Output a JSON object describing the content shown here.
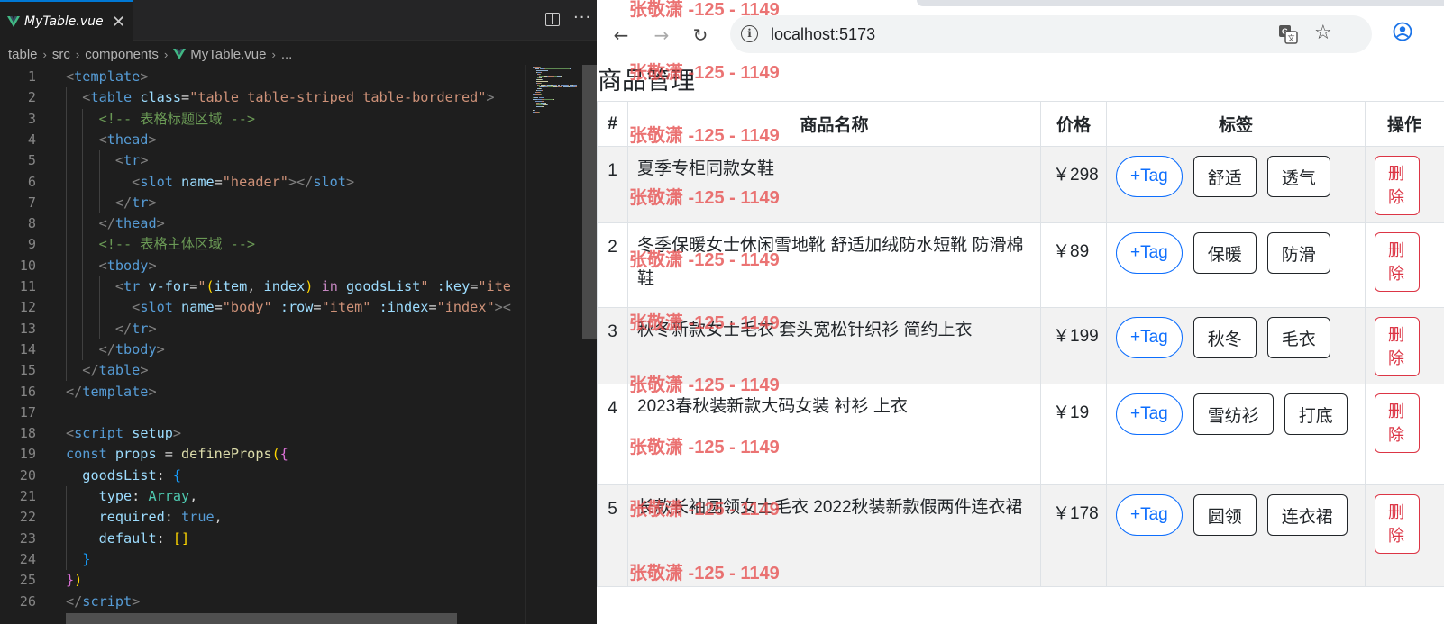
{
  "editor": {
    "tab_label": "MyTable.vue",
    "tab_close": "✕",
    "more_glyph": "···",
    "breadcrumb": [
      "table",
      "src",
      "components",
      "MyTable.vue",
      "..."
    ],
    "breadcrumb_sep": "›",
    "line_numbers": [
      "1",
      "2",
      "3",
      "4",
      "5",
      "6",
      "7",
      "8",
      "9",
      "10",
      "11",
      "12",
      "13",
      "14",
      "15",
      "16",
      "17",
      "18",
      "19",
      "20",
      "21",
      "22",
      "23",
      "24",
      "25",
      "26"
    ],
    "code": [
      [
        [
          "t-br",
          "<"
        ],
        [
          "t-tag",
          "template"
        ],
        [
          "t-br",
          ">"
        ]
      ],
      [
        [
          "t-d",
          "  "
        ],
        [
          "t-br",
          "<"
        ],
        [
          "t-tag",
          "table"
        ],
        [
          "t-d",
          " "
        ],
        [
          "t-attr",
          "class"
        ],
        [
          "t-d",
          "="
        ],
        [
          "t-str",
          "\"table table-striped table-bordered\""
        ],
        [
          "t-br",
          ">"
        ]
      ],
      [
        [
          "t-d",
          "    "
        ],
        [
          "t-com",
          "<!-- 表格标题区域 -->"
        ]
      ],
      [
        [
          "t-d",
          "    "
        ],
        [
          "t-br",
          "<"
        ],
        [
          "t-tag",
          "thead"
        ],
        [
          "t-br",
          ">"
        ]
      ],
      [
        [
          "t-d",
          "      "
        ],
        [
          "t-br",
          "<"
        ],
        [
          "t-tag",
          "tr"
        ],
        [
          "t-br",
          ">"
        ]
      ],
      [
        [
          "t-d",
          "        "
        ],
        [
          "t-br",
          "<"
        ],
        [
          "t-tag",
          "slot"
        ],
        [
          "t-d",
          " "
        ],
        [
          "t-attr",
          "name"
        ],
        [
          "t-d",
          "="
        ],
        [
          "t-str",
          "\"header\""
        ],
        [
          "t-br",
          "></"
        ],
        [
          "t-tag",
          "slot"
        ],
        [
          "t-br",
          ">"
        ]
      ],
      [
        [
          "t-d",
          "      "
        ],
        [
          "t-br",
          "</"
        ],
        [
          "t-tag",
          "tr"
        ],
        [
          "t-br",
          ">"
        ]
      ],
      [
        [
          "t-d",
          "    "
        ],
        [
          "t-br",
          "</"
        ],
        [
          "t-tag",
          "thead"
        ],
        [
          "t-br",
          ">"
        ]
      ],
      [
        [
          "t-d",
          "    "
        ],
        [
          "t-com",
          "<!-- 表格主体区域 -->"
        ]
      ],
      [
        [
          "t-d",
          "    "
        ],
        [
          "t-br",
          "<"
        ],
        [
          "t-tag",
          "tbody"
        ],
        [
          "t-br",
          ">"
        ]
      ],
      [
        [
          "t-d",
          "      "
        ],
        [
          "t-br",
          "<"
        ],
        [
          "t-tag",
          "tr"
        ],
        [
          "t-d",
          " "
        ],
        [
          "t-attr",
          "v-for"
        ],
        [
          "t-d",
          "="
        ],
        [
          "t-str",
          "\""
        ],
        [
          "t-p1",
          "("
        ],
        [
          "t-var",
          "item"
        ],
        [
          "t-d",
          ", "
        ],
        [
          "t-var",
          "index"
        ],
        [
          "t-p1",
          ")"
        ],
        [
          "t-d",
          " "
        ],
        [
          "t-ctl",
          "in"
        ],
        [
          "t-d",
          " "
        ],
        [
          "t-var",
          "goodsList"
        ],
        [
          "t-str",
          "\""
        ],
        [
          "t-d",
          " "
        ],
        [
          "t-attr",
          ":key"
        ],
        [
          "t-d",
          "="
        ],
        [
          "t-str",
          "\"ite"
        ]
      ],
      [
        [
          "t-d",
          "        "
        ],
        [
          "t-br",
          "<"
        ],
        [
          "t-tag",
          "slot"
        ],
        [
          "t-d",
          " "
        ],
        [
          "t-attr",
          "name"
        ],
        [
          "t-d",
          "="
        ],
        [
          "t-str",
          "\"body\""
        ],
        [
          "t-d",
          " "
        ],
        [
          "t-attr",
          ":row"
        ],
        [
          "t-d",
          "="
        ],
        [
          "t-str",
          "\"item\""
        ],
        [
          "t-d",
          " "
        ],
        [
          "t-attr",
          ":index"
        ],
        [
          "t-d",
          "="
        ],
        [
          "t-str",
          "\"index\""
        ],
        [
          "t-br",
          "><"
        ]
      ],
      [
        [
          "t-d",
          "      "
        ],
        [
          "t-br",
          "</"
        ],
        [
          "t-tag",
          "tr"
        ],
        [
          "t-br",
          ">"
        ]
      ],
      [
        [
          "t-d",
          "    "
        ],
        [
          "t-br",
          "</"
        ],
        [
          "t-tag",
          "tbody"
        ],
        [
          "t-br",
          ">"
        ]
      ],
      [
        [
          "t-d",
          "  "
        ],
        [
          "t-br",
          "</"
        ],
        [
          "t-tag",
          "table"
        ],
        [
          "t-br",
          ">"
        ]
      ],
      [
        [
          "t-br",
          "</"
        ],
        [
          "t-tag",
          "template"
        ],
        [
          "t-br",
          ">"
        ]
      ],
      [],
      [
        [
          "t-br",
          "<"
        ],
        [
          "t-tag",
          "script"
        ],
        [
          "t-d",
          " "
        ],
        [
          "t-attr",
          "setup"
        ],
        [
          "t-br",
          ">"
        ]
      ],
      [
        [
          "t-kw",
          "const"
        ],
        [
          "t-d",
          " "
        ],
        [
          "t-var",
          "props"
        ],
        [
          "t-d",
          " = "
        ],
        [
          "t-fn",
          "defineProps"
        ],
        [
          "t-p1",
          "("
        ],
        [
          "t-p2",
          "{"
        ]
      ],
      [
        [
          "t-d",
          "  "
        ],
        [
          "t-var",
          "goodsList"
        ],
        [
          "t-d",
          ": "
        ],
        [
          "t-p3",
          "{"
        ]
      ],
      [
        [
          "t-d",
          "    "
        ],
        [
          "t-var",
          "type"
        ],
        [
          "t-d",
          ": "
        ],
        [
          "t-type",
          "Array"
        ],
        [
          "t-d",
          ","
        ]
      ],
      [
        [
          "t-d",
          "    "
        ],
        [
          "t-var",
          "required"
        ],
        [
          "t-d",
          ": "
        ],
        [
          "t-kw",
          "true"
        ],
        [
          "t-d",
          ","
        ]
      ],
      [
        [
          "t-d",
          "    "
        ],
        [
          "t-var",
          "default"
        ],
        [
          "t-d",
          ": "
        ],
        [
          "t-p1",
          "[]"
        ]
      ],
      [
        [
          "t-d",
          "  "
        ],
        [
          "t-p3",
          "}"
        ]
      ],
      [
        [
          "t-p2",
          "}"
        ],
        [
          "t-p1",
          ")"
        ]
      ],
      [
        [
          "t-br",
          "</"
        ],
        [
          "t-tag",
          "script"
        ],
        [
          "t-br",
          ">"
        ]
      ]
    ]
  },
  "browser": {
    "back_glyph": "←",
    "forward_glyph": "→",
    "reload_glyph": "↻",
    "url": "localhost:5173",
    "star_glyph": "☆",
    "info_glyph": "i",
    "icons": [
      "back-icon",
      "forward-icon",
      "reload-icon",
      "info-icon",
      "translate-icon",
      "star-icon",
      "profile-icon"
    ]
  },
  "page": {
    "title": "商品管理",
    "headers": [
      "#",
      "商品名称",
      "价格",
      "标签",
      "操作"
    ],
    "add_tag_label": "+Tag",
    "delete_label": "删除",
    "rows": [
      {
        "index": "1",
        "name": "夏季专柜同款女鞋",
        "price": "￥298",
        "tags": [
          "舒适",
          "透气"
        ]
      },
      {
        "index": "2",
        "name": "冬季保暖女士休闲雪地靴 舒适加绒防水短靴 防滑棉鞋",
        "price": "￥89",
        "tags": [
          "保暖",
          "防滑"
        ]
      },
      {
        "index": "3",
        "name": "秋冬新款女士毛衣 套头宽松针织衫 简约上衣",
        "price": "￥199",
        "tags": [
          "秋冬",
          "毛衣"
        ]
      },
      {
        "index": "4",
        "name": "2023春秋装新款大码女装 衬衫 上衣",
        "price": "￥19",
        "tags": [
          "雪纺衫",
          "打底"
        ]
      },
      {
        "index": "5",
        "name": "长款长袖圆领女士毛衣 2022秋装新款假两件连衣裙",
        "price": "￥178",
        "tags": [
          "圆领",
          "连衣裙"
        ]
      }
    ]
  },
  "watermark": "张敬潇 -125 - 1149",
  "colors": {
    "accent_blue": "#0d6efd",
    "danger_red": "#dc3545",
    "editor_bg": "#1e1e1e",
    "watermark": "#e65050"
  }
}
